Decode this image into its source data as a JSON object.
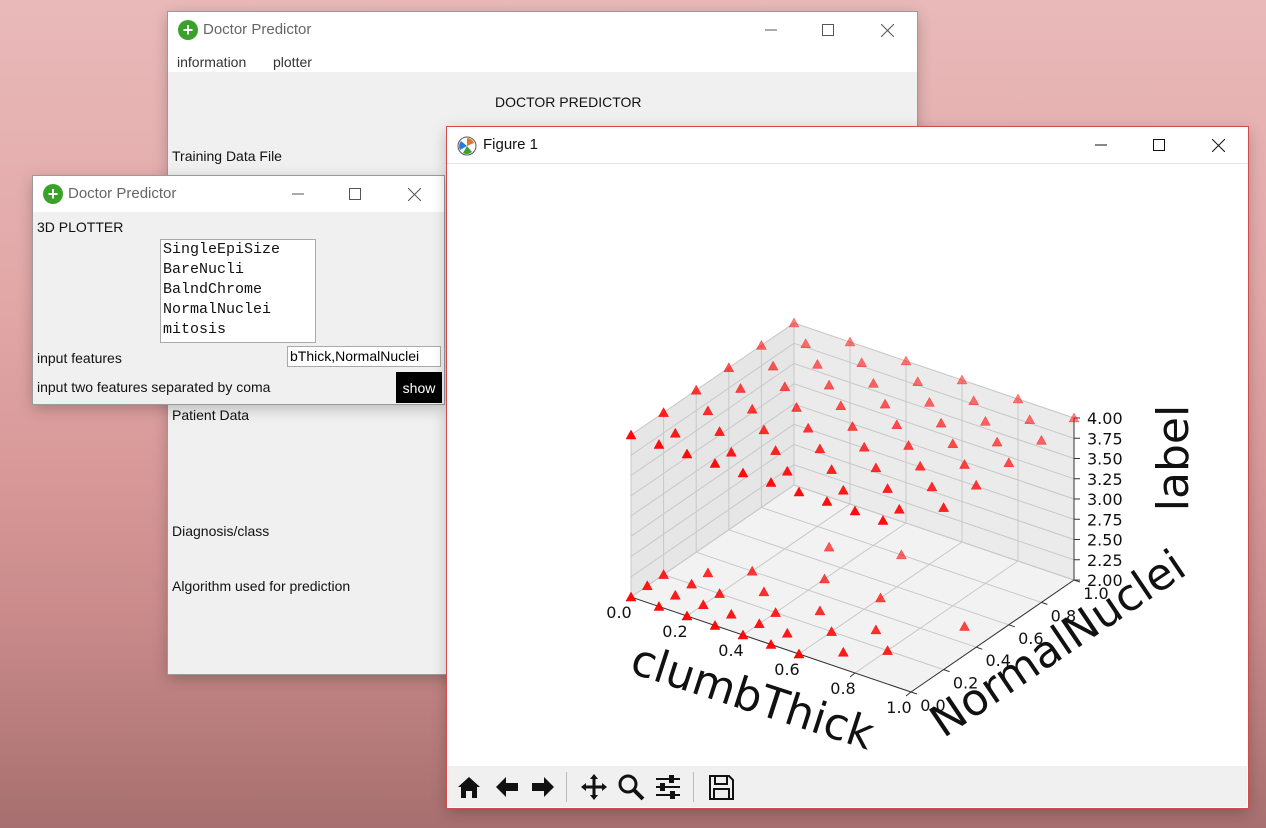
{
  "main_window": {
    "title": "Doctor Predictor",
    "menu": [
      "information",
      "plotter"
    ],
    "heading": "DOCTOR PREDICTOR",
    "training_label": "Training Data File",
    "patient_label": "Patient Data",
    "diagnosis_label": "Diagnosis/class",
    "algorithm_label": "Algorithm used for prediction"
  },
  "plotter_window": {
    "title": "Doctor Predictor",
    "heading": "3D PLOTTER",
    "feature_list": [
      "SingleEpiSize",
      "BareNucli",
      "BalndChrome",
      "NormalNuclei",
      "mitosis"
    ],
    "input_label": "input features",
    "input_value": "bThick,NormalNuclei",
    "hint": "input two features separated by coma",
    "show_label": "show"
  },
  "figure_window": {
    "title": "Figure 1",
    "toolbar": [
      "home-icon",
      "back-icon",
      "forward-icon",
      "pan-icon",
      "zoom-icon",
      "configure-icon",
      "save-icon"
    ]
  },
  "chart_data": {
    "type": "scatter",
    "projection": "3d",
    "xlabel": "clumbThick",
    "ylabel": "NormalNuclei",
    "zlabel": "label",
    "xlim": [
      0.0,
      1.0
    ],
    "ylim": [
      0.0,
      1.0
    ],
    "zlim": [
      2.0,
      4.0
    ],
    "xticks": [
      "0.0",
      "0.2",
      "0.4",
      "0.6",
      "0.8",
      "1.0"
    ],
    "yticks": [
      "0.0",
      "0.2",
      "0.4",
      "0.6",
      "0.8",
      "1.0"
    ],
    "zticks": [
      "2.00",
      "2.25",
      "2.50",
      "2.75",
      "3.00",
      "3.25",
      "3.50",
      "3.75",
      "4.00"
    ],
    "marker": "triangle",
    "color": "#ff0000",
    "grid": true,
    "series": [
      {
        "points": [
          [
            0.0,
            0.0,
            2
          ],
          [
            0.1,
            0.0,
            2
          ],
          [
            0.2,
            0.0,
            2
          ],
          [
            0.3,
            0.0,
            2
          ],
          [
            0.4,
            0.0,
            2
          ],
          [
            0.5,
            0.0,
            2
          ],
          [
            0.6,
            0.0,
            2
          ],
          [
            0.0,
            0.1,
            2
          ],
          [
            0.1,
            0.1,
            2
          ],
          [
            0.2,
            0.1,
            2
          ],
          [
            0.3,
            0.1,
            2
          ],
          [
            0.4,
            0.1,
            2
          ],
          [
            0.5,
            0.1,
            2
          ],
          [
            0.7,
            0.1,
            2
          ],
          [
            0.0,
            0.2,
            2
          ],
          [
            0.1,
            0.2,
            2
          ],
          [
            0.2,
            0.2,
            2
          ],
          [
            0.4,
            0.2,
            2
          ],
          [
            0.6,
            0.2,
            2
          ],
          [
            0.8,
            0.2,
            2
          ],
          [
            0.1,
            0.3,
            2
          ],
          [
            0.3,
            0.3,
            2
          ],
          [
            0.5,
            0.3,
            2
          ],
          [
            0.7,
            0.3,
            2
          ],
          [
            0.2,
            0.4,
            2
          ],
          [
            0.4,
            0.5,
            2
          ],
          [
            0.6,
            0.5,
            2
          ],
          [
            0.9,
            0.5,
            2
          ],
          [
            0.3,
            0.7,
            2
          ],
          [
            0.5,
            0.8,
            2
          ],
          [
            0.0,
            0.0,
            4
          ],
          [
            0.1,
            0.0,
            4
          ],
          [
            0.2,
            0.0,
            4
          ],
          [
            0.3,
            0.0,
            4
          ],
          [
            0.4,
            0.0,
            4
          ],
          [
            0.5,
            0.0,
            4
          ],
          [
            0.6,
            0.0,
            4
          ],
          [
            0.7,
            0.0,
            4
          ],
          [
            0.8,
            0.0,
            4
          ],
          [
            0.9,
            0.0,
            4
          ],
          [
            0.1,
            0.1,
            4
          ],
          [
            0.3,
            0.1,
            4
          ],
          [
            0.5,
            0.1,
            4
          ],
          [
            0.7,
            0.1,
            4
          ],
          [
            0.9,
            0.1,
            4
          ],
          [
            0.0,
            0.2,
            4
          ],
          [
            0.2,
            0.2,
            4
          ],
          [
            0.4,
            0.2,
            4
          ],
          [
            0.6,
            0.2,
            4
          ],
          [
            0.8,
            0.2,
            4
          ],
          [
            1.0,
            0.2,
            4
          ],
          [
            0.1,
            0.3,
            4
          ],
          [
            0.3,
            0.3,
            4
          ],
          [
            0.5,
            0.3,
            4
          ],
          [
            0.7,
            0.3,
            4
          ],
          [
            0.9,
            0.3,
            4
          ],
          [
            0.0,
            0.4,
            4
          ],
          [
            0.2,
            0.4,
            4
          ],
          [
            0.4,
            0.4,
            4
          ],
          [
            0.6,
            0.4,
            4
          ],
          [
            0.8,
            0.4,
            4
          ],
          [
            1.0,
            0.4,
            4
          ],
          [
            0.1,
            0.5,
            4
          ],
          [
            0.3,
            0.5,
            4
          ],
          [
            0.5,
            0.5,
            4
          ],
          [
            0.7,
            0.5,
            4
          ],
          [
            0.9,
            0.5,
            4
          ],
          [
            0.0,
            0.6,
            4
          ],
          [
            0.2,
            0.6,
            4
          ],
          [
            0.4,
            0.6,
            4
          ],
          [
            0.6,
            0.6,
            4
          ],
          [
            0.8,
            0.6,
            4
          ],
          [
            1.0,
            0.6,
            4
          ],
          [
            0.1,
            0.7,
            4
          ],
          [
            0.3,
            0.7,
            4
          ],
          [
            0.5,
            0.7,
            4
          ],
          [
            0.7,
            0.7,
            4
          ],
          [
            0.9,
            0.7,
            4
          ],
          [
            0.0,
            0.8,
            4
          ],
          [
            0.2,
            0.8,
            4
          ],
          [
            0.4,
            0.8,
            4
          ],
          [
            0.6,
            0.8,
            4
          ],
          [
            0.8,
            0.8,
            4
          ],
          [
            1.0,
            0.8,
            4
          ],
          [
            0.1,
            0.9,
            4
          ],
          [
            0.3,
            0.9,
            4
          ],
          [
            0.5,
            0.9,
            4
          ],
          [
            0.7,
            0.9,
            4
          ],
          [
            0.9,
            0.9,
            4
          ],
          [
            0.0,
            1.0,
            4
          ],
          [
            0.2,
            1.0,
            4
          ],
          [
            0.4,
            1.0,
            4
          ],
          [
            0.6,
            1.0,
            4
          ],
          [
            0.8,
            1.0,
            4
          ],
          [
            1.0,
            1.0,
            4
          ]
        ]
      }
    ]
  }
}
